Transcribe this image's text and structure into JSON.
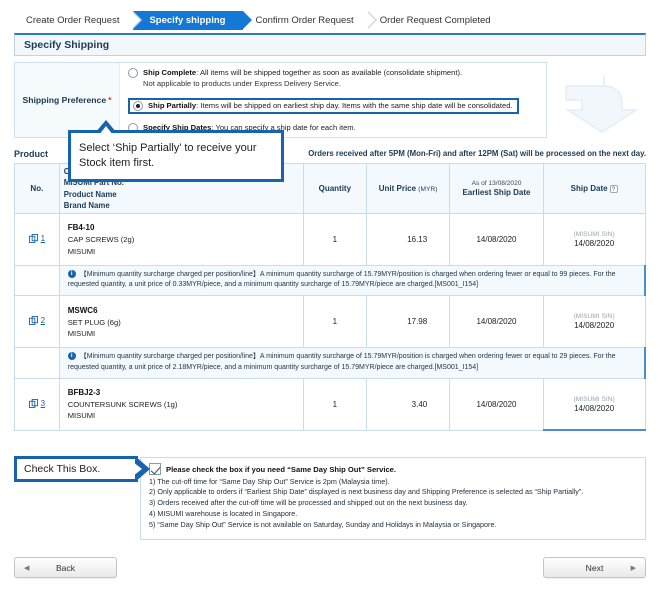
{
  "steps": [
    {
      "label": "Create Order Request",
      "active": false
    },
    {
      "label": "Specify shipping",
      "active": true
    },
    {
      "label": "Confirm Order Request",
      "active": false
    },
    {
      "label": "Order Request Completed",
      "active": false
    }
  ],
  "section": {
    "title": "Specify Shipping"
  },
  "shipping_preference": {
    "label": "Shipping Preference",
    "required_mark": "*",
    "options": [
      {
        "name": "Ship Complete",
        "description": ": All items will be shipped together as soon as available (consolidate shipment).",
        "sub": "Not applicable to products under Express Delivery Service.",
        "selected": false,
        "highlighted": false
      },
      {
        "name": "Ship Partially",
        "description": ": Items will be shipped on earliest ship day. Items with the same ship date will be consolidated.",
        "sub": "",
        "selected": true,
        "highlighted": true
      },
      {
        "name": "Specify Ship Dates",
        "description": ": You can specify a ship date for each item.",
        "sub": "",
        "selected": false,
        "highlighted": false
      }
    ]
  },
  "product_section": {
    "label": "Product",
    "note": "Orders received after 5PM (Mon-Fri) and after 12PM (Sat) will be processed on the next day."
  },
  "table": {
    "headers": {
      "no": "No.",
      "product_lines": [
        "Customer Part No.",
        "MISUMI Part No.",
        "Product Name",
        "Brand Name"
      ],
      "quantity": "Quantity",
      "unit_price": "Unit Price",
      "unit_price_currency": "(MYR)",
      "earliest_ship_date_asof": "As of 13/08/2020",
      "earliest_ship_date": "Earliest Ship Date",
      "ship_date": "Ship Date",
      "ship_date_help_icon": "question-mark-icon"
    },
    "rows": [
      {
        "no": "1",
        "part_no": "FB4-10",
        "product_name": "CAP SCREWS  (2g)",
        "brand_name": "MISUMI",
        "quantity": "1",
        "unit_price": "16.13",
        "earliest_ship_date": "14/08/2020",
        "ship_date_source": "(MISUMI SIN)",
        "ship_date": "14/08/2020",
        "note": "【Minimum quantity surcharge charged per position/line】A minimum quantity surcharge of 15.79MYR/position is charged when ordering fewer or equal to 99 pieces. For the requested quantity, a unit price of 0.33MYR/piece, and a minimum quantity surcharge of 15.79MYR/piece are charged.[MS001_I154]"
      },
      {
        "no": "2",
        "part_no": "MSWC6",
        "product_name": "SET PLUG  (6g)",
        "brand_name": "MISUMI",
        "quantity": "1",
        "unit_price": "17.98",
        "earliest_ship_date": "14/08/2020",
        "ship_date_source": "(MISUMI SIN)",
        "ship_date": "14/08/2020",
        "note": "【Minimum quantity surcharge charged per position/line】A minimum quantity surcharge of 15.79MYR/position is charged when ordering fewer or equal to 29 pieces. For the requested quantity, a unit price of 2.18MYR/piece, and a minimum quantity surcharge of 15.79MYR/piece are charged.[MS001_I154]"
      },
      {
        "no": "3",
        "part_no": "BFBJ2-3",
        "product_name": "COUNTERSUNK SCREWS  (1g)",
        "brand_name": "MISUMI",
        "quantity": "1",
        "unit_price": "3.40",
        "earliest_ship_date": "14/08/2020",
        "ship_date_source": "(MISUMI SIN)",
        "ship_date": "14/08/2020",
        "note": ""
      }
    ]
  },
  "same_day_ship_out": {
    "checked": true,
    "title": "Please check the box if you need “Same Day Ship Out” Service.",
    "notes": [
      "1) The cut-off time for “Same Day Ship Out” Service is  2pm (Malaysia time).",
      "2) Only applicable to orders if “Earliest Ship Date” displayed is next business day and Shipping Preference is selected as “Ship Partially”.",
      "3) Orders received after the cut-off time will be processed and shipped out on the next business day.",
      "4) MISUMI warehouse is located in Singapore.",
      "5) “Same Day Ship Out” Service is not available on Saturday, Sunday and Holidays in Malaysia or Singapore."
    ]
  },
  "callouts": {
    "ship_partially": "Select ‘Ship Partially’ to receive your Stock item first.",
    "check_box": "Check This Box."
  },
  "footer": {
    "back": "Back",
    "next": "Next",
    "back_arrow": "◀",
    "next_arrow": "▶"
  },
  "colors": {
    "accent_blue": "#1479d4",
    "callout_border": "#1763ad",
    "panel_bg": "#f5fafd",
    "grid_border": "#c9dcec",
    "highlight_border": "#4a90c8"
  }
}
